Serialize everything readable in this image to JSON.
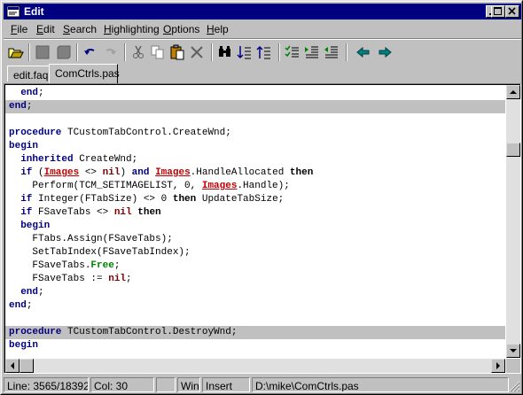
{
  "window": {
    "title": "Edit"
  },
  "menu": [
    {
      "pre": "",
      "u": "F",
      "post": "ile"
    },
    {
      "pre": "",
      "u": "E",
      "post": "dit"
    },
    {
      "pre": "",
      "u": "S",
      "post": "earch"
    },
    {
      "pre": "",
      "u": "H",
      "post": "ighlighting"
    },
    {
      "pre": "",
      "u": "O",
      "post": "ptions"
    },
    {
      "pre": "",
      "u": "H",
      "post": "elp"
    }
  ],
  "tabs": [
    {
      "label": "edit.faq",
      "active": false
    },
    {
      "label": "ComCtrls.pas",
      "active": true
    }
  ],
  "toolbar": {
    "tools": [
      "open-icon",
      "save-icon",
      "save-all-icon",
      "undo-icon",
      "redo-icon",
      "cut-icon",
      "copy-icon",
      "paste-icon",
      "delete-icon",
      "find-icon",
      "sort-ascending-icon",
      "sort-descending-icon",
      "check-list-icon",
      "indent-icon",
      "outdent-icon",
      "prev-arrow-icon",
      "next-arrow-icon"
    ]
  },
  "code_lines": [
    "  <span class=\"kwb\">end</span>;",
    "<span class=\"kwb\">end</span>;",
    "",
    "<span class=\"kwb\">procedure</span> TCustomTabControl.CreateWnd;",
    "<span class=\"kwb\">begin</span>",
    "  <span class=\"kwb\">inherited</span> CreateWnd;",
    "  <span class=\"kwb\">if</span> (<span class=\"img\">Images</span> <> <span class=\"kwr\">nil</span>) <span class=\"kwb\">and</span> <span class=\"img\">Images</span>.HandleAllocated <span class=\"kw\">then</span>",
    "    Perform(TCM_SETIMAGELIST, 0, <span class=\"img\">Images</span>.Handle);",
    "  <span class=\"kwb\">if</span> Integer(FTabSize) <> 0 <span class=\"kw\">then</span> UpdateTabSize;",
    "  <span class=\"kwb\">if</span> FSaveTabs <> <span class=\"kwr\">nil</span> <span class=\"kw\">then</span>",
    "  <span class=\"kwb\">begin</span>",
    "    FTabs.Assign(FSaveTabs);",
    "    SetTabIndex(FSaveTabIndex);",
    "    FSaveTabs.<span class=\"kwg\">Free</span>;",
    "    FSaveTabs := <span class=\"kwr\">nil</span>;",
    "  <span class=\"kwb\">end</span>;",
    "<span class=\"kwb\">end</span>;",
    "",
    "<span class=\"kwb\">procedure</span> TCustomTabControl.DestroyWnd;",
    "<span class=\"kwb\">begin</span>"
  ],
  "highlighted_lines": [
    1,
    18
  ],
  "scroll": {
    "vertical_position_fraction": 0.19
  },
  "status": {
    "line": "Line: 3565/18392",
    "col": "Col:  30",
    "empty1": "",
    "mode": "Win",
    "insert": "Insert",
    "path": "D:\\mike\\ComCtrls.pas"
  }
}
